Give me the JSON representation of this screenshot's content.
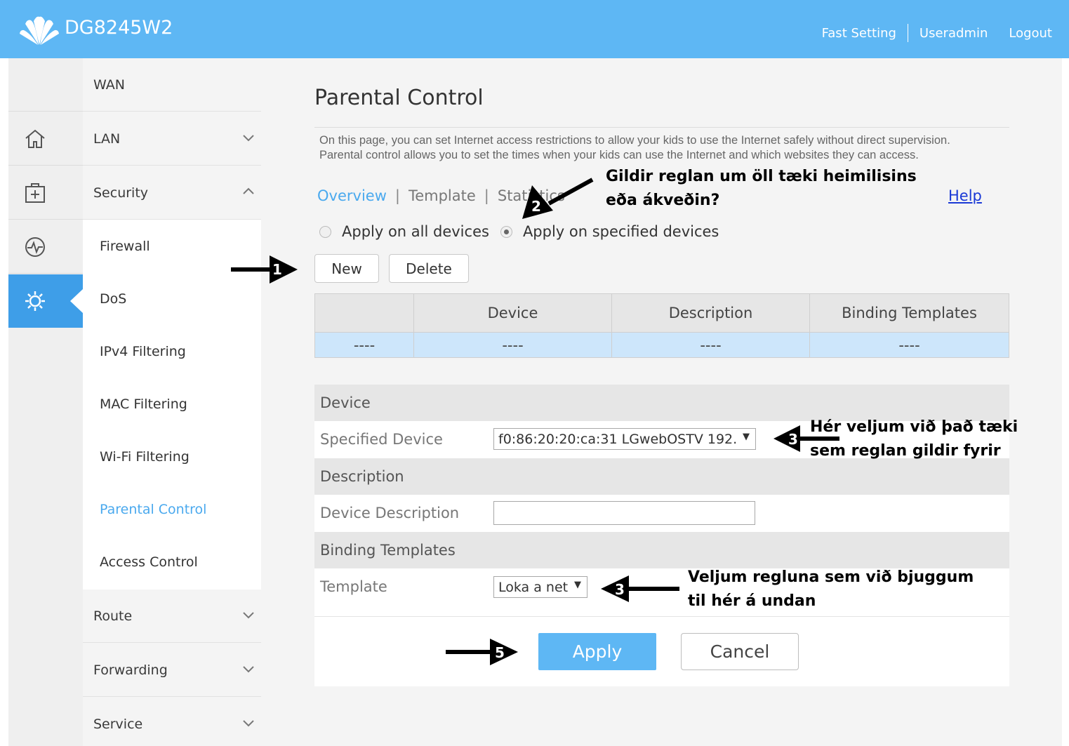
{
  "header": {
    "brand": "DG8245W2",
    "links": [
      "Fast Setting",
      "Useradmin",
      "Logout"
    ]
  },
  "rail": {
    "icons": [
      "home-icon",
      "add-box-icon",
      "pulse-icon",
      "gear-icon"
    ],
    "active": "gear-icon"
  },
  "menu": {
    "wan": "WAN",
    "lan": "LAN",
    "security": "Security",
    "route": "Route",
    "forwarding": "Forwarding",
    "service": "Service",
    "security_items": [
      "Firewall",
      "DoS",
      "IPv4 Filtering",
      "MAC Filtering",
      "Wi-Fi Filtering",
      "Parental Control",
      "Access Control"
    ],
    "active_item": "Parental Control"
  },
  "page": {
    "title": "Parental Control",
    "description_line1": "On this page, you can set Internet access restrictions to allow your kids to use the Internet safely without direct supervision.",
    "description_line2": "Parental control allows you to set the times when your kids can use the Internet and which websites they can access.",
    "tabs": [
      "Overview",
      "Template",
      "Statistics"
    ],
    "active_tab": "Overview",
    "help": "Help",
    "radio_all": "Apply on all devices",
    "radio_specified": "Apply on specified devices",
    "selected_radio": "Apply on specified devices",
    "new_button": "New",
    "delete_button": "Delete"
  },
  "table": {
    "headers": [
      "",
      "Device",
      "Description",
      "Binding Templates"
    ],
    "rows": [
      [
        "----",
        "----",
        "----",
        "----"
      ]
    ]
  },
  "form": {
    "section_device": "Device",
    "label_specified_device": "Specified Device",
    "specified_device_value": "f0:86:20:20:ca:31  LGwebOSTV  192.",
    "section_description": "Description",
    "label_device_description": "Device Description",
    "device_description_value": "",
    "section_binding": "Binding Templates",
    "label_template": "Template",
    "template_value": "Loka a net",
    "apply_button": "Apply",
    "cancel_button": "Cancel"
  },
  "annotations": {
    "note_radio_line1": "Gildir reglan um öll tæki heimilisins",
    "note_radio_line2": "eða ákveðin?",
    "note_device_line1": "Hér veljum við það tæki",
    "note_device_line2": "sem reglan gildir fyrir",
    "note_template_line1": "Veljum regluna sem við bjuggum",
    "note_template_line2": "til hér á undan",
    "numbers": [
      "1",
      "2",
      "3",
      "3",
      "5"
    ]
  },
  "colors": {
    "header": "#5eb7f4",
    "active_rail": "#3e9ee8",
    "link_active": "#4aa9ee",
    "help_link": "#1a39d6",
    "table_row": "#cde6fb"
  }
}
